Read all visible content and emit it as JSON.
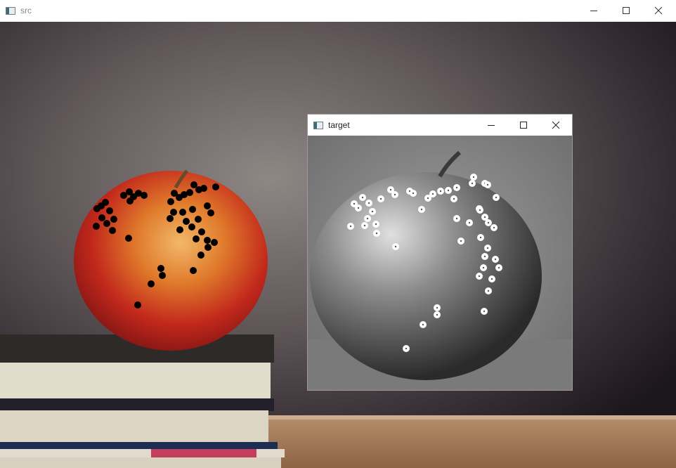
{
  "src_window": {
    "title": "src",
    "controls": [
      "minimize",
      "maximize",
      "close"
    ],
    "marker_color": "#000000"
  },
  "target_window": {
    "title": "target",
    "controls": [
      "minimize",
      "maximize",
      "close"
    ],
    "marker_color": "#ffffff"
  },
  "icons": {
    "minimize": "minimize-icon",
    "maximize": "maximize-icon",
    "close": "close-icon",
    "app": "opencv-window-icon"
  }
}
